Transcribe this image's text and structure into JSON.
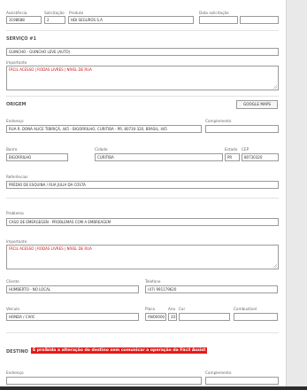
{
  "header": {
    "assistencia_label": "Assistência",
    "assistencia_value": "3198688",
    "solicitacao_label": "Solicitação",
    "solicitacao_value": "2",
    "produto_label": "Produto",
    "produto_value": "HDI SEGUROS S.A",
    "data_label": "Data solicitação",
    "data_value_1": "",
    "data_value_2": ""
  },
  "servico": {
    "title": "SERVIÇO #1",
    "service_value": "GUINCHO - GUINCHO LEVE (AUTO)",
    "importante_label": "Importante",
    "importante_value": "FÁCIL ACESSO | RODAS LIVRES | NÍVEL DE RUA"
  },
  "origem": {
    "title": "ORIGEM",
    "maps_button": "GOOGLE MAPS",
    "endereco_label": "Endereço",
    "endereco_value": "RUA R. DONA ALICE TIBIRIÇÁ, 445 - BIGORRILHO, CURITIBA - PR, 80730-320, BRASIL, 445",
    "complemento_label": "Complemento",
    "complemento_value": "",
    "bairro_label": "Bairro",
    "bairro_value": "BIGORRILHO",
    "cidade_label": "Cidade",
    "cidade_value": "CURITIBA",
    "estado_label": "Estado",
    "estado_value": "PR",
    "cep_label": "CEP",
    "cep_value": "80730320",
    "referencias_label": "Referências",
    "referencias_value": "PRÉDIO DE ESQUINA / RUA JULIA DA COSTA",
    "problema_label": "Problema",
    "problema_value": "CASO DE EMERGEGEN - PROBLEMAS COM A EMBREAGEM",
    "importante_label": "Importante",
    "importante_value": "FÁCIL ACESSO | RODAS LIVRES | NÍVEL DE RUA",
    "cliente_label": "Cliente",
    "cliente_value": "HUMBERTO - NO LOCAL",
    "telefone_label": "Telefone",
    "telefone_value": "(47) 991179620",
    "veiculo_label": "Veículo",
    "veiculo_value": "HONDA / CIVIC",
    "placa_label": "Placa",
    "placa_value": "ANO0000",
    "ano_label": "Ano",
    "ano_value": "2013",
    "cor_label": "Cor",
    "cor_value": "",
    "combustivel_label": "Combustível",
    "combustivel_value": ""
  },
  "destino": {
    "title": "DESTINO",
    "warning": "É proibida a alteração do destino sem comunicar a operação da Fácil Assist",
    "endereco_label": "Endereço",
    "complemento_label": "Complemento"
  },
  "colors": {
    "warning_bg": "#e31b1b",
    "important_text": "#d01010"
  }
}
